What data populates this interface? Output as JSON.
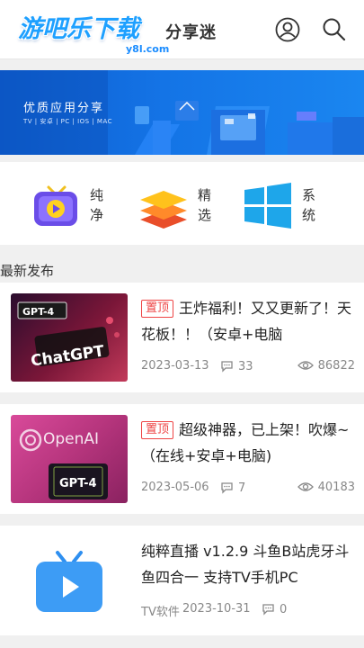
{
  "header": {
    "logo_main": "游吧乐下载",
    "logo_sub": "y8l.com",
    "logo_tag": "分享迷",
    "user_icon": "user-icon",
    "search_icon": "search-icon"
  },
  "banner": {
    "title": "优质应用分享",
    "subtitle": "TV | 安卓 | PC | IOS | MAC"
  },
  "categories": [
    {
      "label": "纯净",
      "icon": "tv-play-icon"
    },
    {
      "label": "精选",
      "icon": "layers-icon"
    },
    {
      "label": "系统",
      "icon": "windows-icon"
    }
  ],
  "section_title": "最新发布",
  "posts": [
    {
      "badge": "置顶",
      "title": "王炸福利！又又更新了！天花板！！（安卓+电脑",
      "date": "2023-03-13",
      "comments": "33",
      "views": "86822",
      "thumb_text_1": "GPT-4",
      "thumb_text_2": "ChatGPT"
    },
    {
      "badge": "置顶",
      "title": "超级神器，已上架！吹爆~（在线+安卓+电脑)",
      "date": "2023-05-06",
      "comments": "7",
      "views": "40183",
      "thumb_text_1": "OpenAI",
      "thumb_text_2": "GPT-4"
    },
    {
      "title": "纯粹直播 v1.2.9 斗鱼B站虎牙斗鱼四合一 支持TV手机PC",
      "category": "TV软件",
      "date": "2023-10-31",
      "comments": "0"
    }
  ],
  "colors": {
    "accent": "#1a86f0",
    "badge": "#e44444",
    "meta": "#888888"
  }
}
